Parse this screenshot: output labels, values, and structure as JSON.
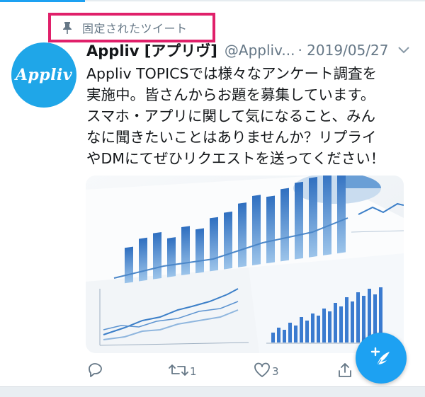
{
  "pinned": {
    "label": "固定されたツイート"
  },
  "avatar": {
    "text": "Appliv"
  },
  "tweet": {
    "display_name": "Appliv [アプリヴ]",
    "handle": "@Appliv...",
    "date": "· 2019/05/27",
    "text_lines": [
      "Appliv TOPICSでは様々なアンケート調査を",
      "実施中。皆さんからお題を募集しています。",
      "スマホ・アプリに関して気になること、みん",
      "なに聞きたいことはありませんか？リプライ",
      "やDMにてぜひリクエストを送ってください！"
    ],
    "media_icon": "analytics-charts-photo"
  },
  "actions": {
    "reply_count": "",
    "retweet_count": "1",
    "like_count": "3",
    "share_label": ""
  },
  "fab": {
    "icon": "compose-feather-icon"
  },
  "colors": {
    "accent": "#1da1f2",
    "highlight_border": "#e0206a",
    "muted_text": "#657786",
    "avatar_bg": "#1fa6e8"
  }
}
